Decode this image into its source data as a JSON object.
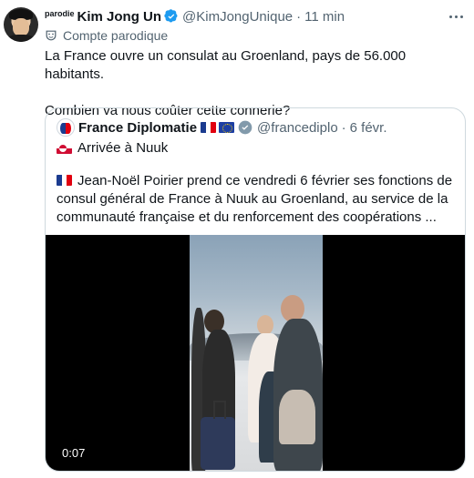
{
  "tweet": {
    "parody_tag": "parodie",
    "display_name": "Kim Jong Un",
    "handle": "@KimJongUnique",
    "separator": "·",
    "time": "11 min",
    "parody_label": "Compte parodique",
    "text_line1": "La France ouvre un consulat au Groenland, pays de 56.000 habitants.",
    "text_line2": "Combien va nous coûter cette connerie?"
  },
  "quote": {
    "display_name": "France Diplomatie",
    "handle": "@francediplo",
    "separator": "·",
    "time": "6 févr.",
    "arrival": "Arrivée à Nuuk",
    "body": "Jean-Noël Poirier prend ce vendredi 6 février ses fonctions de consul général de France à Nuuk au Groenland, au service de la communauté française et du renforcement des coopérations ...",
    "video_time": "0:07"
  },
  "colors": {
    "verified_blue": "#1d9bf0",
    "gov_gray": "#829aab",
    "text_secondary": "#536471",
    "border": "#cfd9de"
  },
  "icons": {
    "more": "more-icon",
    "verified": "verified-badge-icon",
    "parody": "parody-mask-icon",
    "gov": "government-badge-icon"
  }
}
